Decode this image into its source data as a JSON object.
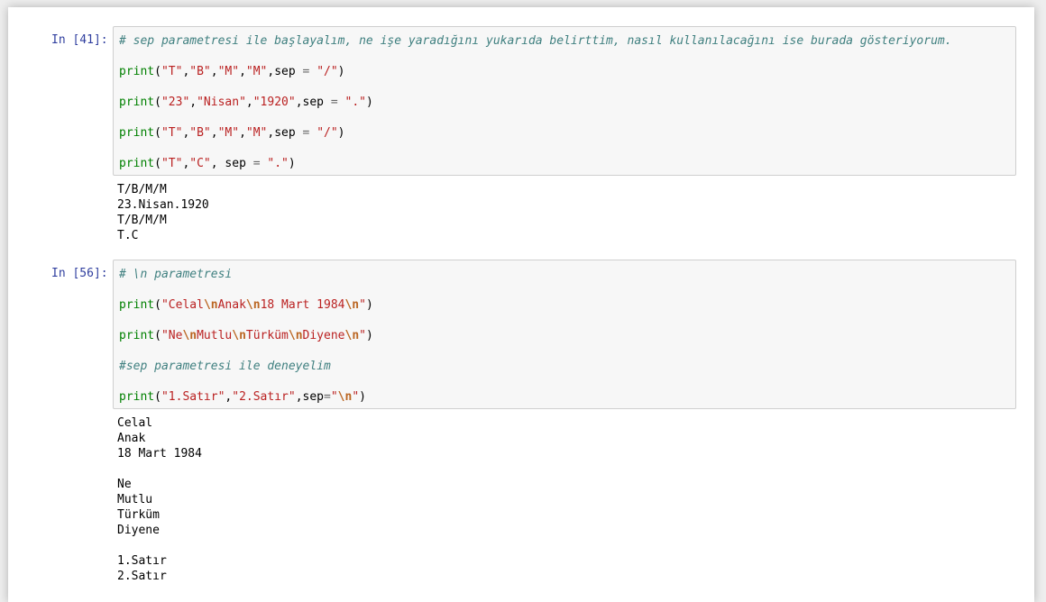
{
  "cells": [
    {
      "prompt": "In [41]:",
      "code": [
        [
          {
            "t": "comment",
            "s": "# sep parametresi ile başlayalım, ne işe yaradığını yukarıda belirttim, nasıl kullanılacağını ise burada gösteriyorum."
          }
        ],
        [
          {
            "t": "builtin",
            "s": "print"
          },
          {
            "t": "plain",
            "s": "("
          },
          {
            "t": "string",
            "s": "\"T\""
          },
          {
            "t": "plain",
            "s": ","
          },
          {
            "t": "string",
            "s": "\"B\""
          },
          {
            "t": "plain",
            "s": ","
          },
          {
            "t": "string",
            "s": "\"M\""
          },
          {
            "t": "plain",
            "s": ","
          },
          {
            "t": "string",
            "s": "\"M\""
          },
          {
            "t": "plain",
            "s": ",sep "
          },
          {
            "t": "op",
            "s": "="
          },
          {
            "t": "plain",
            "s": " "
          },
          {
            "t": "string",
            "s": "\"/\""
          },
          {
            "t": "plain",
            "s": ")"
          }
        ],
        [
          {
            "t": "builtin",
            "s": "print"
          },
          {
            "t": "plain",
            "s": "("
          },
          {
            "t": "string",
            "s": "\"23\""
          },
          {
            "t": "plain",
            "s": ","
          },
          {
            "t": "string",
            "s": "\"Nisan\""
          },
          {
            "t": "plain",
            "s": ","
          },
          {
            "t": "string",
            "s": "\"1920\""
          },
          {
            "t": "plain",
            "s": ",sep "
          },
          {
            "t": "op",
            "s": "="
          },
          {
            "t": "plain",
            "s": " "
          },
          {
            "t": "string",
            "s": "\".\""
          },
          {
            "t": "plain",
            "s": ")"
          }
        ],
        [
          {
            "t": "builtin",
            "s": "print"
          },
          {
            "t": "plain",
            "s": "("
          },
          {
            "t": "string",
            "s": "\"T\""
          },
          {
            "t": "plain",
            "s": ","
          },
          {
            "t": "string",
            "s": "\"B\""
          },
          {
            "t": "plain",
            "s": ","
          },
          {
            "t": "string",
            "s": "\"M\""
          },
          {
            "t": "plain",
            "s": ","
          },
          {
            "t": "string",
            "s": "\"M\""
          },
          {
            "t": "plain",
            "s": ",sep "
          },
          {
            "t": "op",
            "s": "="
          },
          {
            "t": "plain",
            "s": " "
          },
          {
            "t": "string",
            "s": "\"/\""
          },
          {
            "t": "plain",
            "s": ")"
          }
        ],
        [
          {
            "t": "builtin",
            "s": "print"
          },
          {
            "t": "plain",
            "s": "("
          },
          {
            "t": "string",
            "s": "\"T\""
          },
          {
            "t": "plain",
            "s": ","
          },
          {
            "t": "string",
            "s": "\"C\""
          },
          {
            "t": "plain",
            "s": ", sep "
          },
          {
            "t": "op",
            "s": "="
          },
          {
            "t": "plain",
            "s": " "
          },
          {
            "t": "string",
            "s": "\".\""
          },
          {
            "t": "plain",
            "s": ")"
          }
        ]
      ],
      "output": [
        "T/B/M/M",
        "23.Nisan.1920",
        "T/B/M/M",
        "T.C"
      ]
    },
    {
      "prompt": "In [56]:",
      "code": [
        [
          {
            "t": "comment",
            "s": "# \\n parametresi"
          }
        ],
        [
          {
            "t": "builtin",
            "s": "print"
          },
          {
            "t": "plain",
            "s": "("
          },
          {
            "t": "string",
            "s": "\"Celal"
          },
          {
            "t": "escape",
            "s": "\\n"
          },
          {
            "t": "string",
            "s": "Anak"
          },
          {
            "t": "escape",
            "s": "\\n"
          },
          {
            "t": "string",
            "s": "18 Mart 1984"
          },
          {
            "t": "escape",
            "s": "\\n"
          },
          {
            "t": "string",
            "s": "\""
          },
          {
            "t": "plain",
            "s": ")"
          }
        ],
        [
          {
            "t": "builtin",
            "s": "print"
          },
          {
            "t": "plain",
            "s": "("
          },
          {
            "t": "string",
            "s": "\"Ne"
          },
          {
            "t": "escape",
            "s": "\\n"
          },
          {
            "t": "string",
            "s": "Mutlu"
          },
          {
            "t": "escape",
            "s": "\\n"
          },
          {
            "t": "string",
            "s": "Türküm"
          },
          {
            "t": "escape",
            "s": "\\n"
          },
          {
            "t": "string",
            "s": "Diyene"
          },
          {
            "t": "escape",
            "s": "\\n"
          },
          {
            "t": "string",
            "s": "\""
          },
          {
            "t": "plain",
            "s": ")"
          }
        ],
        [
          {
            "t": "comment",
            "s": "#sep parametresi ile deneyelim"
          }
        ],
        [
          {
            "t": "builtin",
            "s": "print"
          },
          {
            "t": "plain",
            "s": "("
          },
          {
            "t": "string",
            "s": "\"1.Satır\""
          },
          {
            "t": "plain",
            "s": ","
          },
          {
            "t": "string",
            "s": "\"2.Satır\""
          },
          {
            "t": "plain",
            "s": ",sep"
          },
          {
            "t": "op",
            "s": "="
          },
          {
            "t": "string",
            "s": "\""
          },
          {
            "t": "escape",
            "s": "\\n"
          },
          {
            "t": "string",
            "s": "\""
          },
          {
            "t": "plain",
            "s": ")"
          }
        ]
      ],
      "output": [
        "Celal",
        "Anak",
        "18 Mart 1984",
        "",
        "Ne",
        "Mutlu",
        "Türküm",
        "Diyene",
        "",
        "1.Satır",
        "2.Satır"
      ]
    }
  ]
}
